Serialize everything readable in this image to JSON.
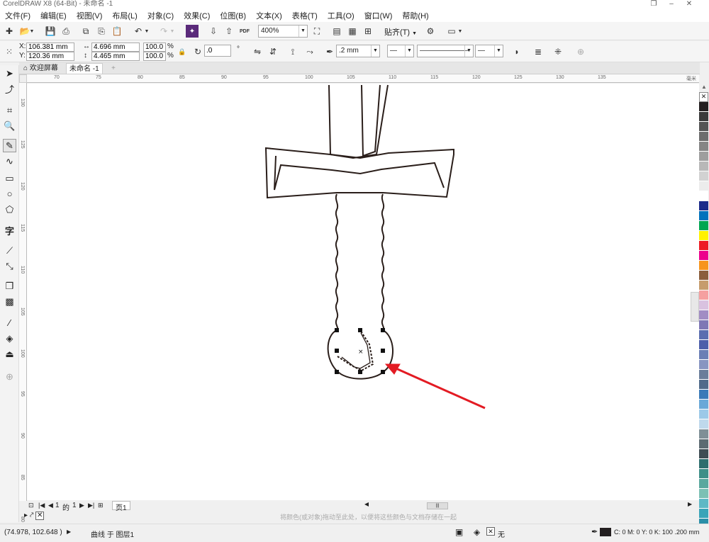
{
  "window": {
    "title": "CorelDRAW X8 (64-Bit) - 未命名 -1"
  },
  "menu": [
    "文件(F)",
    "编辑(E)",
    "视图(V)",
    "布局(L)",
    "对象(C)",
    "效果(C)",
    "位图(B)",
    "文本(X)",
    "表格(T)",
    "工具(O)",
    "窗口(W)",
    "帮助(H)"
  ],
  "toolbar": {
    "zoom": "400%",
    "snap_label": "贴齐(T)",
    "pdf_label": "PDF"
  },
  "property_bar": {
    "x": "106.381 mm",
    "y": "120.36 mm",
    "width": "4.696 mm",
    "height": "4.465 mm",
    "scale_w": "100.0",
    "scale_h": "100.0",
    "pct": "%",
    "x_label": "X:",
    "y_label": "Y:",
    "rotation": ".0",
    "outline_width": ".2 mm"
  },
  "tabs": [
    {
      "label": "欢迎屏幕"
    },
    {
      "label": "未命名 -1"
    }
  ],
  "ruler": {
    "h_ticks": [
      "70",
      "75",
      "80",
      "85",
      "90",
      "95",
      "100",
      "105",
      "110",
      "115",
      "120",
      "125",
      "130",
      "135"
    ],
    "unit": "毫米",
    "v_ticks": [
      "130",
      "125",
      "120",
      "115",
      "110",
      "105",
      "100",
      "95",
      "90",
      "85",
      "80"
    ]
  },
  "page_nav": {
    "current": "1",
    "of_label": "的",
    "total": "1",
    "page_tab": "页1"
  },
  "hint_text": "将颜色(或对象)拖动至此处，以便将这些颜色与文档存储在一起",
  "status": {
    "coords": "(74.978, 102.648 )",
    "object_info": "曲线 于 图层1",
    "fill_none": "无",
    "outline_color_info": "C: 0 M: 0 Y: 0 K: 100  .200 mm"
  },
  "palette_colors": [
    "#231f20",
    "#3a3a3a",
    "#555555",
    "#6d6d6d",
    "#858585",
    "#9e9e9e",
    "#b8b8b8",
    "#d2d2d2",
    "#ececec",
    "#ffffff",
    "#1b2a8a",
    "#0072bc",
    "#00a651",
    "#fff200",
    "#ed1c24",
    "#ec008c",
    "#f7941d",
    "#8b5e3c",
    "#c69c6d",
    "#f5a0a0",
    "#d9c2e0",
    "#a18dc4",
    "#7e77b5",
    "#5b6eb0",
    "#4d5faa",
    "#6b7fb5",
    "#8795c1",
    "#6a7d9a",
    "#4f6a8a",
    "#3a7ab8",
    "#6aa8d8",
    "#9cc9e8",
    "#bfd9ec",
    "#7f8f96",
    "#5d6b72",
    "#3e4c53",
    "#2e6e6e",
    "#3f8f88",
    "#5aa89e",
    "#7cc0b4",
    "#5fb8c5",
    "#3aa4b8",
    "#2b8fa8"
  ],
  "accent": {
    "annotation_arrow": "#e31b23",
    "drawing_stroke": "#2a1e1a"
  }
}
